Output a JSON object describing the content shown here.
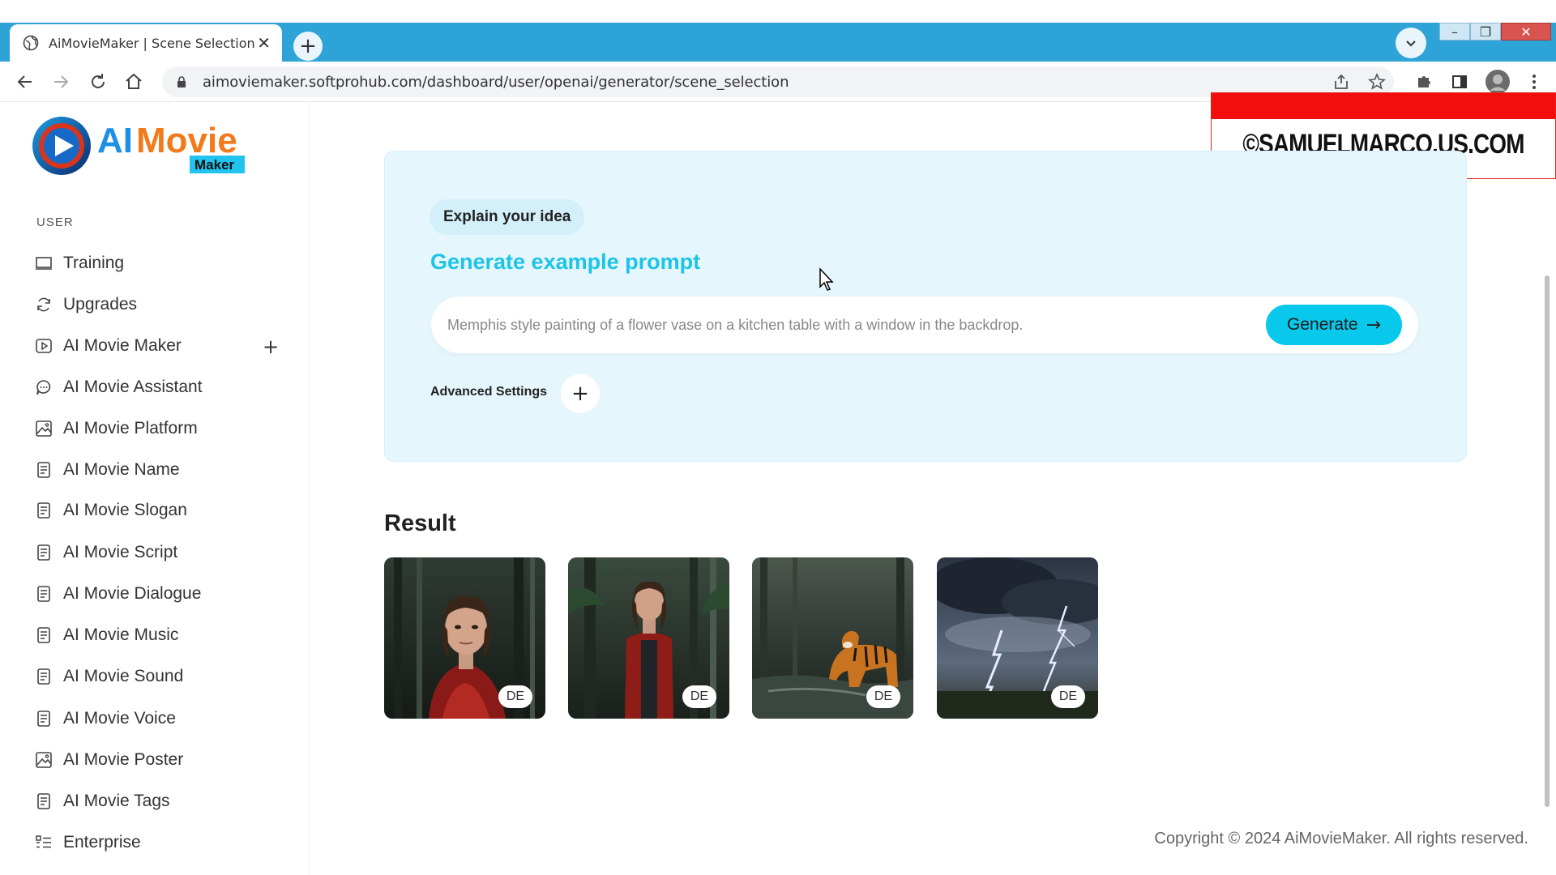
{
  "browser": {
    "tab_title": "AiMovieMaker | Scene Selection",
    "tab_close": "✕",
    "new_tab": "+",
    "url": "aimoviemaker.softprohub.com/dashboard/user/openai/generator/scene_selection",
    "window_controls": {
      "minimize": "–",
      "maximize": "❐",
      "close": "✕"
    }
  },
  "watermark": {
    "text": "©SAMUELMARCO.US.COM"
  },
  "logo": {
    "primary": "AIMovie",
    "secondary": "Maker"
  },
  "sidebar": {
    "section_label": "USER",
    "items": [
      {
        "label": "Training",
        "icon": "monitor-icon"
      },
      {
        "label": "Upgrades",
        "icon": "refresh-icon"
      },
      {
        "label": "AI Movie Maker",
        "icon": "play-icon"
      },
      {
        "label": "AI Movie Assistant",
        "icon": "chat-icon"
      },
      {
        "label": "AI Movie Platform",
        "icon": "image-icon"
      },
      {
        "label": "AI Movie Name",
        "icon": "document-icon"
      },
      {
        "label": "AI Movie Slogan",
        "icon": "document-icon"
      },
      {
        "label": "AI Movie Script",
        "icon": "document-icon"
      },
      {
        "label": "AI Movie Dialogue",
        "icon": "document-icon"
      },
      {
        "label": "AI Movie Music",
        "icon": "document-icon"
      },
      {
        "label": "AI Movie Sound",
        "icon": "document-icon"
      },
      {
        "label": "AI Movie Voice",
        "icon": "document-icon"
      },
      {
        "label": "AI Movie Poster",
        "icon": "image-icon"
      },
      {
        "label": "AI Movie Tags",
        "icon": "document-icon"
      },
      {
        "label": "Enterprise",
        "icon": "list-icon"
      }
    ],
    "expand_symbol": "+"
  },
  "idea": {
    "chip": "Explain your idea",
    "example_link": "Generate example prompt",
    "placeholder": "Memphis style painting of a flower vase on a kitchen table with a window in the backdrop.",
    "generate_label": "Generate",
    "generate_arrow": "→",
    "advanced_label": "Advanced Settings",
    "advanced_plus": "+"
  },
  "result": {
    "title": "Result",
    "thumbnails": [
      {
        "badge": "DE",
        "subject": "woman-red-jacket-forest-portrait"
      },
      {
        "badge": "DE",
        "subject": "woman-red-jacket-forest-full"
      },
      {
        "badge": "DE",
        "subject": "tiger-forest-stream"
      },
      {
        "badge": "DE",
        "subject": "lightning-storm"
      }
    ]
  },
  "footer": {
    "copyright": "Copyright © 2024 AiMovieMaker. All rights reserved."
  },
  "colors": {
    "accent": "#08c8ec",
    "link": "#1cc4e6",
    "card_bg": "#e6f6fd",
    "tabbar": "#2ea3d8",
    "watermark_red": "#f40d0d"
  }
}
